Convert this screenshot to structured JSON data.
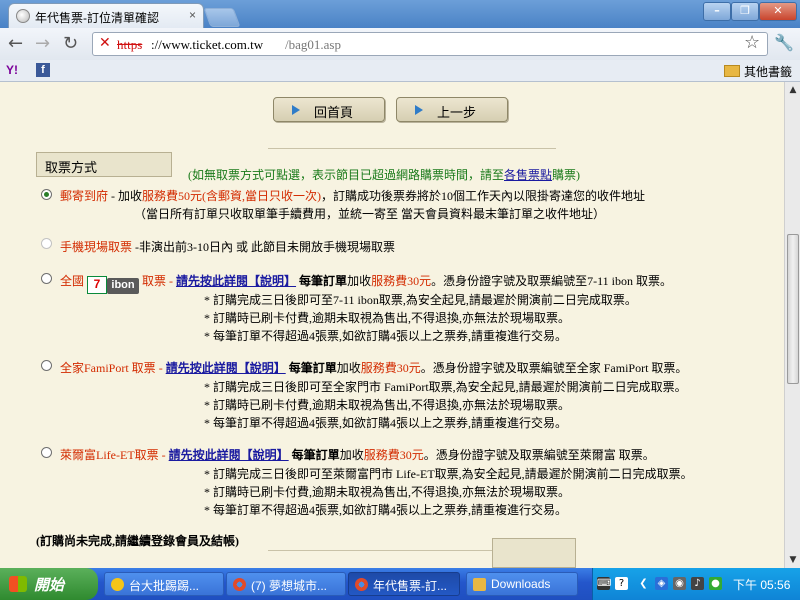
{
  "browser": {
    "tab_title": "年代售票-訂位清單確認",
    "tab_close": "×",
    "window_buttons": [
      "–",
      "❐",
      "✕"
    ],
    "nav": {
      "back": "←",
      "forward": "→",
      "reload": "↻"
    },
    "url_scheme": "https",
    "url_host": "://www.ticket.com.tw",
    "url_path": "/bag01.asp",
    "insecure_mark": "✕",
    "star": "☆",
    "wrench": "🔧",
    "bookmarks": {
      "yahoo": "Y!",
      "facebook": "f",
      "other": "其他書籤"
    }
  },
  "page": {
    "home_button": "回首頁",
    "back_button": "上一步",
    "method_label": "取票方式",
    "method_note_prefix": "(如無取票方式可點選，表示節目已超過網路購票時間，請至",
    "method_note_link": "各售票點",
    "method_note_suffix": "購票)",
    "mail": {
      "title": "郵寄到府",
      "pre": " - 加收",
      "fee": "服務費50元(含郵資,當日只收一次)",
      "post": "，訂購成功後票券將於10個工作天內以限掛寄達您的收件地址",
      "line2": "（當日所有訂單只收取單筆手續費用，並統一寄至 當天會員資料最末筆訂單之收件地址）"
    },
    "mobile": {
      "title": "手機現場取票",
      "text": " -非演出前3-10日內 或 此節目未開放手機現場取票"
    },
    "seven": {
      "pre": "全國",
      "logo_711": "7",
      "logo_ibon": "ibon",
      "title": "取票",
      "dash": " - ",
      "link": "請先按此詳閱【說明】",
      "mid": "每筆訂單",
      "pre_fee": "加收",
      "fee": "服務費30元",
      "post": "。憑身份證字號及取票編號至7-11 ibon 取票。",
      "notes": [
        "* 訂購完成三日後即可至7-11 ibon取票,為安全起見,請最遲於開演前二日完成取票。",
        "* 訂購時已刷卡付費,逾期未取視為售出,不得退換,亦無法於現場取票。",
        "* 每筆訂單不得超過4張票,如欲訂購4張以上之票券,請重複進行交易。"
      ]
    },
    "family": {
      "title": "全家FamiPort 取票",
      "dash": " - ",
      "link": "請先按此詳閱【說明】",
      "mid": "每筆訂單",
      "pre_fee": "加收",
      "fee": "服務費30元",
      "post": "。憑身份證字號及取票編號至全家 FamiPort 取票。",
      "notes": [
        "* 訂購完成三日後即可至全家門市 FamiPort取票,為安全起見,請最遲於開演前二日完成取票。",
        "* 訂購時已刷卡付費,逾期未取視為售出,不得退換,亦無法於現場取票。",
        "* 每筆訂單不得超過4張票,如欲訂購4張以上之票券,請重複進行交易。"
      ]
    },
    "hilife": {
      "title": "萊爾富Life-ET取票",
      "dash": " - ",
      "link": "請先按此詳閱【說明】",
      "mid": "每筆訂單",
      "pre_fee": "加收",
      "fee": "服務費30元",
      "post": "。憑身份證字號及取票編號至萊爾富 取票。",
      "notes": [
        "* 訂購完成三日後即可至萊爾富門市 Life-ET取票,為安全起見,請最遲於開演前二日完成取票。",
        "* 訂購時已刷卡付費,逾期未取視為售出,不得退換,亦無法於現場取票。",
        "* 每筆訂單不得超過4張票,如欲訂購4張以上之票券,請重複進行交易。"
      ]
    },
    "incomplete_note": "(訂購尚未完成,請繼續登錄會員及結帳)"
  },
  "taskbar": {
    "start": "開始",
    "tasks": [
      "台大批踢踢...",
      "(7) 夢想城市...",
      "年代售票-訂...",
      "Downloads"
    ],
    "clock": "下午 05:56"
  },
  "colors": {
    "page_bg": "#f7f3e1",
    "fee_red": "#d32b00",
    "note_green": "#1a7a1a",
    "link_blue": "#1a1aa0"
  }
}
